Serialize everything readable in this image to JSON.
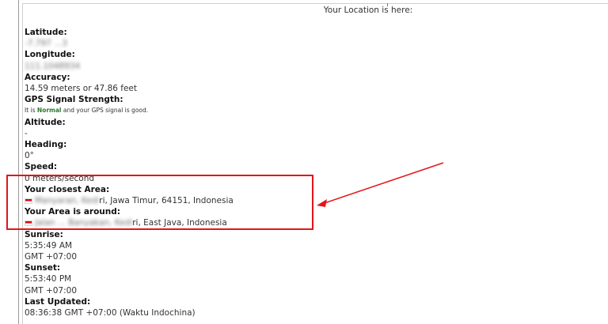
{
  "header": {
    "title": "Your Location is here:"
  },
  "location": {
    "latitude": {
      "label": "Latitude:",
      "value": "-7.797 ...3"
    },
    "longitude": {
      "label": "Longitude:",
      "value": "111.1048934"
    },
    "accuracy": {
      "label": "Accuracy:",
      "value": "14.59 meters or 47.86 feet"
    },
    "gps_signal": {
      "label": "GPS Signal Strength:",
      "prefix": "It is",
      "status": "Normal",
      "suffix": "and your GPS signal is good."
    },
    "altitude": {
      "label": "Altitude:",
      "value": "-"
    },
    "heading": {
      "label": "Heading:",
      "value": "0°"
    },
    "speed": {
      "label": "Speed:",
      "value": "0 meters/second"
    },
    "closest_area": {
      "label": "Your closest Area:",
      "value_blurred": "Manyaran, Kedi",
      "value": "ri, Jawa Timur, 64151, Indonesia"
    },
    "area_around": {
      "label": "Your Area is around:",
      "value_blurred": "Jalan ... Banyakan, Kedi",
      "value": "ri, East Java, Indonesia"
    },
    "sunrise": {
      "label": "Sunrise:",
      "time": "5:35:49 AM",
      "timezone": "GMT +07:00"
    },
    "sunset": {
      "label": "Sunset:",
      "time": "5:53:40 PM",
      "timezone": "GMT +07:00"
    },
    "last_updated": {
      "label": "Last Updated:",
      "value": "08:36:38 GMT +07:00 (Waktu Indochina)"
    }
  },
  "colors": {
    "annotation": "#e3151a",
    "signal_status": "#2b7a2b",
    "flag_red": "#e70011",
    "flag_white": "#ffffff"
  },
  "icons": {
    "flag": "indonesia-flag-icon"
  }
}
